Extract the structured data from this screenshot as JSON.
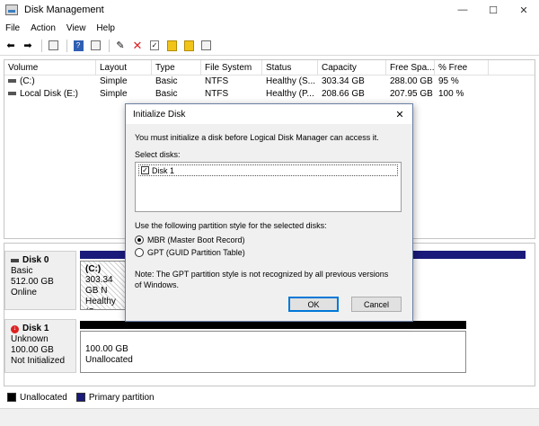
{
  "window": {
    "title": "Disk Management",
    "controls": [
      "—",
      "☐",
      "✕"
    ]
  },
  "menu": [
    "File",
    "Action",
    "View",
    "Help"
  ],
  "volumes": {
    "columns": [
      "Volume",
      "Layout",
      "Type",
      "File System",
      "Status",
      "Capacity",
      "Free Spa...",
      "% Free"
    ],
    "rows": [
      [
        "(C:)",
        "Simple",
        "Basic",
        "NTFS",
        "Healthy (S...",
        "303.34 GB",
        "288.00 GB",
        "95 %"
      ],
      [
        "Local Disk (E:)",
        "Simple",
        "Basic",
        "NTFS",
        "Healthy (P...",
        "208.66 GB",
        "207.95 GB",
        "100 %"
      ]
    ]
  },
  "disks": [
    {
      "name": "Disk 0",
      "type": "Basic",
      "size": "512.00 GB",
      "state": "Online",
      "partition": {
        "label": "(C:)",
        "size": "303.34 GB N",
        "status": "Healthy (Sy"
      }
    },
    {
      "name": "Disk 1",
      "type": "Unknown",
      "size": "100.00 GB",
      "state": "Not Initialized",
      "partition": {
        "size": "100.00 GB",
        "status": "Unallocated"
      }
    }
  ],
  "legend": [
    {
      "label": "Unallocated",
      "color": "#000000"
    },
    {
      "label": "Primary partition",
      "color": "#1a1a7a"
    }
  ],
  "colors": {
    "primary_bar": "#1a1a7a",
    "unallocated_bar": "#000000",
    "accent": "#0078d7"
  },
  "dialog": {
    "title": "Initialize Disk",
    "message": "You must initialize a disk before Logical Disk Manager can access it.",
    "select_label": "Select disks:",
    "disks": [
      {
        "label": "Disk 1",
        "checked": true
      }
    ],
    "style_label": "Use the following partition style for the selected disks:",
    "options": [
      {
        "label": "MBR (Master Boot Record)",
        "selected": true
      },
      {
        "label": "GPT (GUID Partition Table)",
        "selected": false
      }
    ],
    "note": "Note: The GPT partition style is not recognized by all previous versions of Windows.",
    "ok": "OK",
    "cancel": "Cancel"
  }
}
